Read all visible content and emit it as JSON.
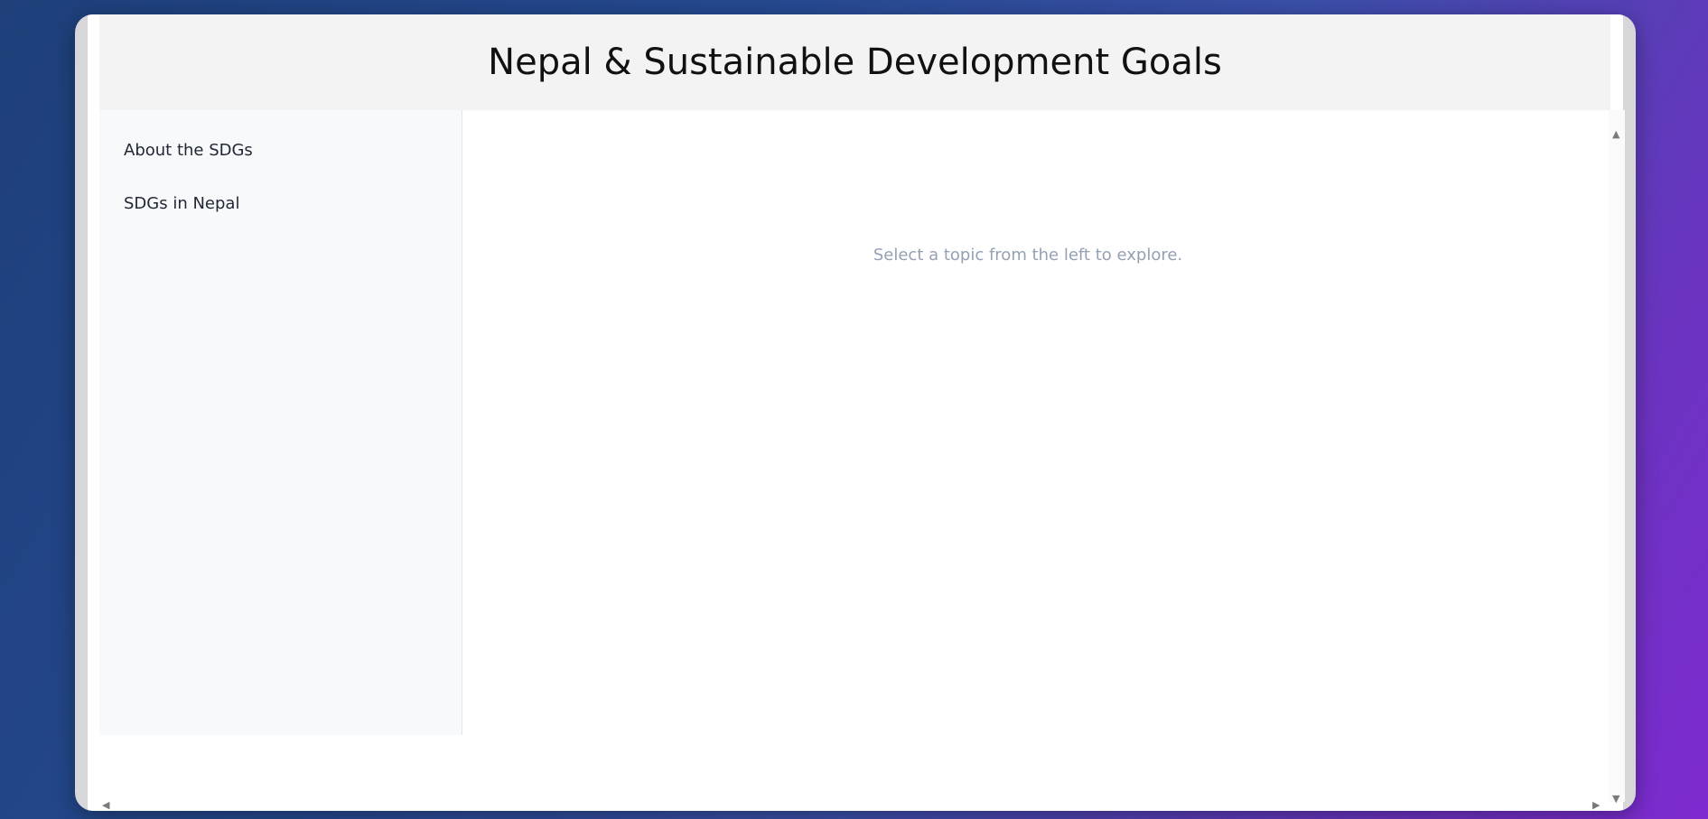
{
  "header": {
    "title": "Nepal & Sustainable Development Goals"
  },
  "sidebar": {
    "items": [
      {
        "label": "About the SDGs"
      },
      {
        "label": "SDGs in Nepal"
      }
    ]
  },
  "main": {
    "placeholder": "Select a topic from the left to explore."
  },
  "scrollbars": {
    "up_icon": "triangle-up",
    "down_icon": "triangle-down",
    "left_icon": "triangle-left",
    "right_icon": "triangle-right"
  },
  "colors": {
    "header_bg": "#f3f3f4",
    "sidebar_bg": "#f7f9fb",
    "placeholder_text": "#95a0b3",
    "background_gradient_start": "#1e3f7a",
    "background_gradient_end": "#7e2ad0"
  }
}
